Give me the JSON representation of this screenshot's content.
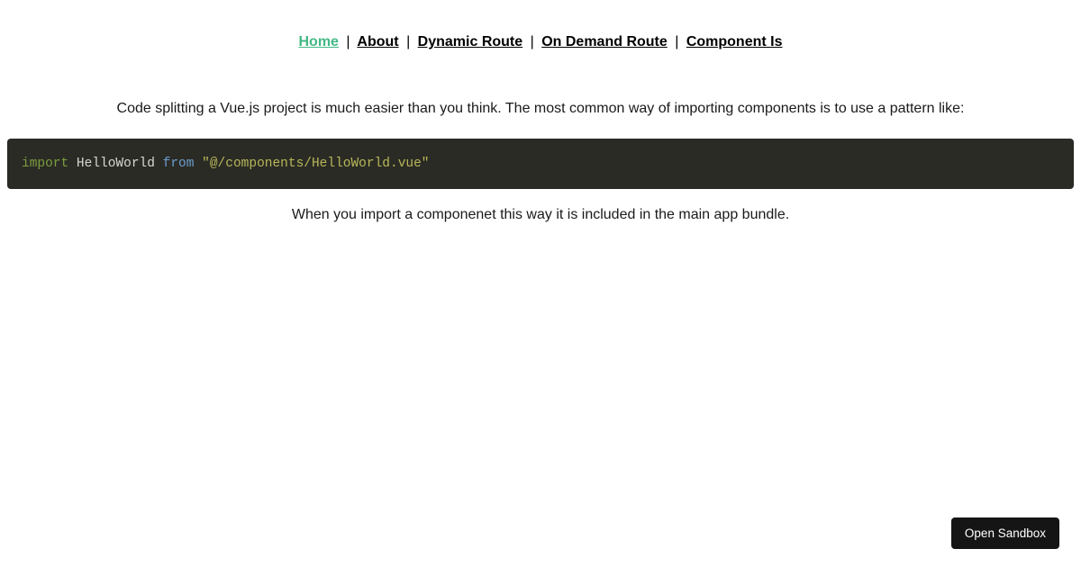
{
  "nav": {
    "items": [
      {
        "label": "Home",
        "active": true
      },
      {
        "label": "About",
        "active": false
      },
      {
        "label": "Dynamic Route",
        "active": false
      },
      {
        "label": "On Demand Route",
        "active": false
      },
      {
        "label": "Component Is",
        "active": false
      }
    ],
    "separator": "|"
  },
  "content": {
    "intro": "Code splitting a Vue.js project is much easier than you think. The most common way of importing components is to use a pattern like:",
    "code": {
      "kw_import": "import",
      "ident": " HelloWorld ",
      "kw_from": "from",
      "str": " \"@/components/HelloWorld.vue\""
    },
    "after": "When you import a componenet this way it is included in the main app bundle."
  },
  "sandbox": {
    "button_label": "Open Sandbox"
  }
}
